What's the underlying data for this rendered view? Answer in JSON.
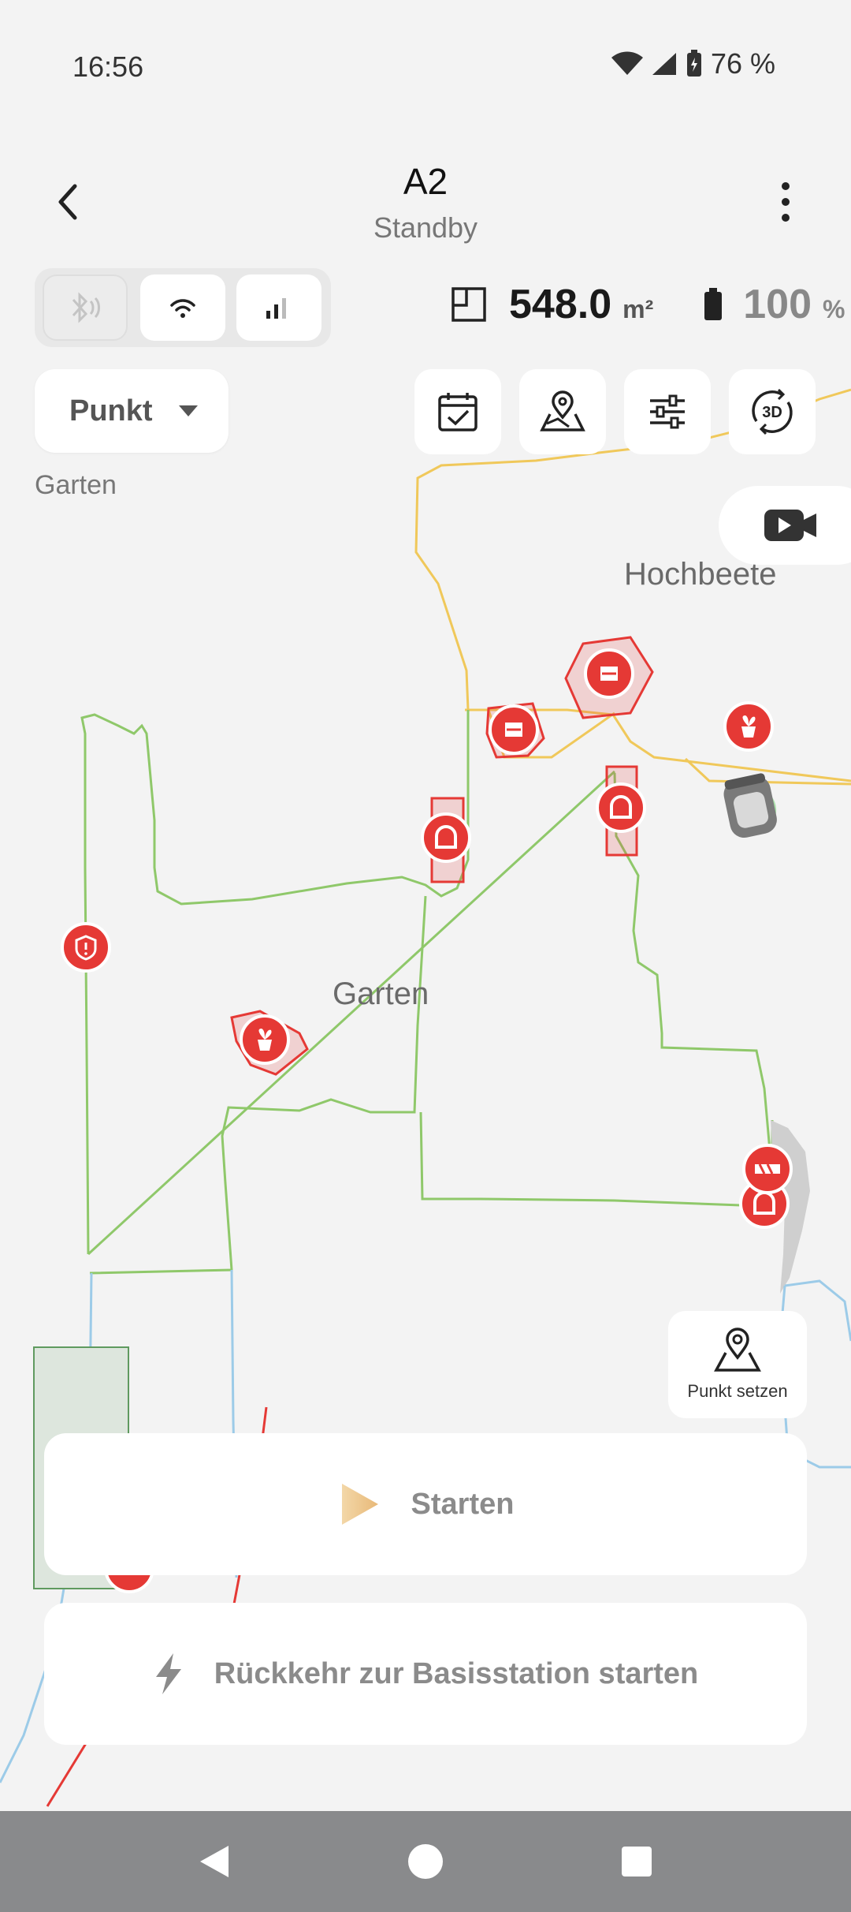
{
  "status_bar": {
    "time": "16:56",
    "battery_text": "76 %",
    "icons": [
      "wifi-icon",
      "cell-signal-icon",
      "battery-charging-icon"
    ]
  },
  "header": {
    "title": "A2",
    "subtitle": "Standby",
    "back_icon": "chevron-left-icon",
    "menu_icon": "more-vertical-icon"
  },
  "connectivity": {
    "buttons": [
      {
        "icon": "bluetooth-icon",
        "state": "disabled"
      },
      {
        "icon": "wifi-icon",
        "state": "enabled"
      },
      {
        "icon": "cellular-signal-icon",
        "state": "enabled"
      }
    ]
  },
  "stats": {
    "area_value": "548.0",
    "area_unit": "m²",
    "battery_value": "100",
    "battery_unit": "%"
  },
  "mode_select": {
    "selected": "Punkt",
    "caption": "Garten"
  },
  "toolbar": {
    "buttons": [
      {
        "icon": "calendar-check-icon"
      },
      {
        "icon": "map-pin-icon"
      },
      {
        "icon": "sliders-icon"
      },
      {
        "icon": "rotate-3d-icon",
        "label": "3D"
      }
    ],
    "video_icon": "video-camera-icon"
  },
  "map": {
    "labels": {
      "hochbeete": "Hochbeete",
      "garten": "Garten"
    },
    "colors": {
      "zone_line": "#8fc86a",
      "path_line": "#f0c85a",
      "marker": "#e53935",
      "water_line": "#9ccbe8"
    }
  },
  "set_point": {
    "label": "Punkt setzen",
    "icon": "map-pin-icon"
  },
  "actions": {
    "start_label": "Starten",
    "start_icon": "play-icon",
    "return_label": "Rückkehr zur Basisstation starten",
    "return_icon": "lightning-icon"
  },
  "navbar": {
    "icons": [
      "nav-back-icon",
      "nav-home-icon",
      "nav-recents-icon"
    ]
  }
}
